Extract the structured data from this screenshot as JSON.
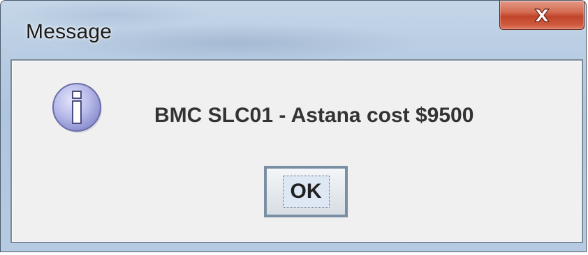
{
  "window": {
    "title": "Message",
    "close_icon": "close-x-icon"
  },
  "dialog": {
    "icon": "info-icon",
    "message": "BMC SLC01 - Astana cost $9500",
    "ok_label": "OK"
  },
  "colors": {
    "close_button": "#c0442a",
    "info_icon": "#b3b6e6",
    "panel_background": "#f0f0f0"
  }
}
